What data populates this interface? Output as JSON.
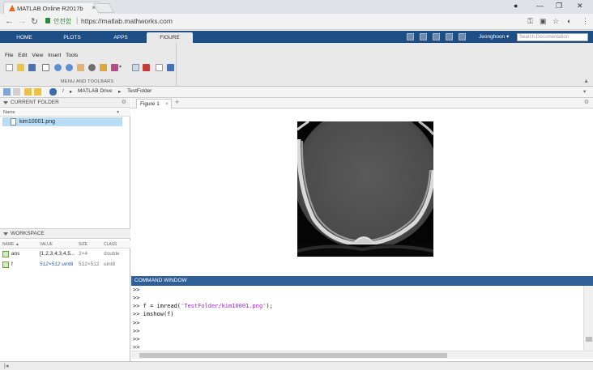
{
  "browser": {
    "tab_title": "MATLAB Online R2017b",
    "tab_close": "×",
    "secure_label": "안전함",
    "separator": "|",
    "url": "https://matlab.mathworks.com"
  },
  "matlab": {
    "tabs": [
      "HOME",
      "PLOTS",
      "APPS",
      "FIGURE"
    ],
    "active_tab": "FIGURE",
    "user": "Jeonghoon ▾",
    "search_placeholder": "Search Documentation"
  },
  "ribbon": {
    "menu": [
      "File",
      "Edit",
      "View",
      "Insert",
      "Tools"
    ],
    "group_label": "MENU AND TOOLBARS"
  },
  "path": {
    "crumbs": [
      "/",
      "▸",
      "MATLAB Drive",
      "▸",
      "TestFolder"
    ]
  },
  "current_folder": {
    "title": "CURRENT FOLDER",
    "column": "Name",
    "files": [
      "kim10001.png"
    ]
  },
  "workspace": {
    "title": "WORKSPACE",
    "columns": [
      "NAME ▲",
      "VALUE",
      "SIZE",
      "CLASS"
    ],
    "rows": [
      {
        "name": "ans",
        "value": "[1,2,3,4;3,4,5...",
        "size": "2×4",
        "class": "double"
      },
      {
        "name": "f",
        "value": "512×512 uint8",
        "size": "512×512",
        "class": "uint8"
      }
    ]
  },
  "figure": {
    "tab_label": "Figure 1",
    "tab_close": "×",
    "add_tab": "+"
  },
  "command_window": {
    "title": "COMMAND WINDOW",
    "lines": [
      {
        "prompt": ">>",
        "code": "",
        "string": "",
        "tail": ""
      },
      {
        "prompt": ">>",
        "code": "",
        "string": "",
        "tail": ""
      },
      {
        "prompt": ">>",
        "code": " f = imread(",
        "string": "'TestFolder/kim10001.png'",
        "tail": ");"
      },
      {
        "prompt": ">>",
        "code": " imshow(f)",
        "string": "",
        "tail": ""
      },
      {
        "prompt": ">>",
        "code": "",
        "string": "",
        "tail": ""
      },
      {
        "prompt": ">>",
        "code": "",
        "string": "",
        "tail": ""
      },
      {
        "prompt": ">>",
        "code": "",
        "string": "",
        "tail": ""
      },
      {
        "prompt": ">>",
        "code": "",
        "string": "",
        "tail": ""
      }
    ]
  },
  "status": {
    "left_icon": "|◂"
  },
  "colors": {
    "toolstrip": "#1d4f86",
    "command_header": "#2f5f97",
    "selection": "#b9dcf7",
    "string_purple": "#a020f0"
  }
}
